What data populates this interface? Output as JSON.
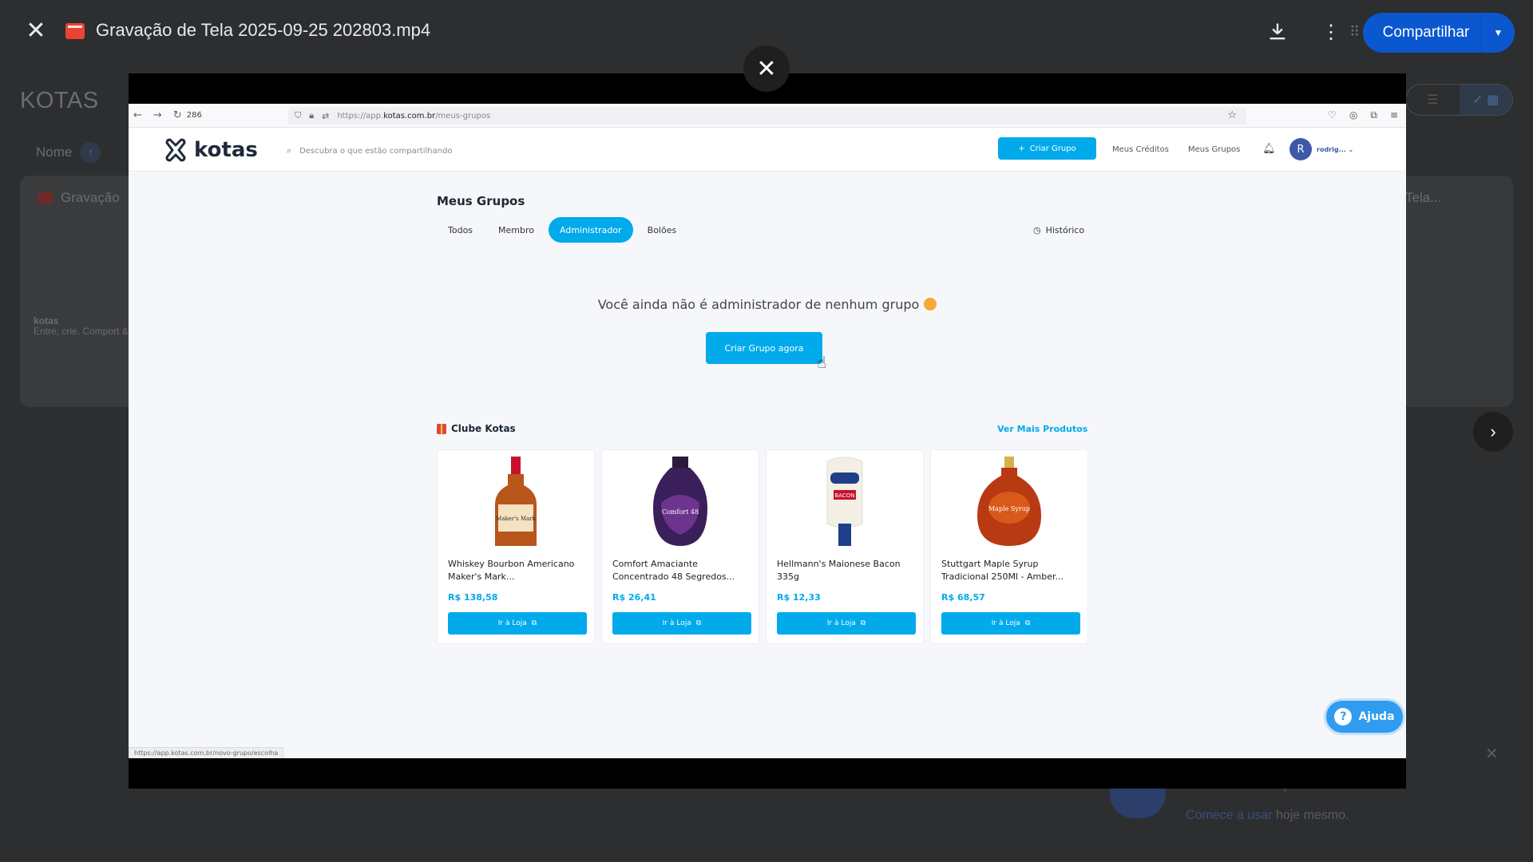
{
  "topbar": {
    "file_title": "Gravação de Tela 2025-09-25 202803.mp4",
    "share_label": "Compartilhar"
  },
  "background": {
    "drive_title": "KOTAS",
    "sort_label": "Nome",
    "card_title": "Gravação",
    "thumb_brand": "kotas",
    "thumb_tagline": "Entre, crie. Comport & curta",
    "right_card_title": "Tela...",
    "toast_line1": "todos os seus arquivos.",
    "toast_link": "Comece a usar",
    "toast_line2_rest": "hoje mesmo."
  },
  "browser": {
    "zoom": "286",
    "url_prefix": "https://app.",
    "url_domain": "kotas.com.br",
    "url_path": "/meus-grupos"
  },
  "kotas": {
    "logo": "kotas",
    "search_placeholder": "Descubra o que estão compartilhando",
    "create_group": "Criar Grupo",
    "my_credits": "Meus Créditos",
    "my_groups": "Meus Grupos",
    "avatar_initial": "R",
    "user_name": "rodrig..."
  },
  "content": {
    "title": "Meus Grupos",
    "tabs": [
      {
        "label": "Todos"
      },
      {
        "label": "Membro"
      },
      {
        "label": "Administrador"
      },
      {
        "label": "Bolões"
      }
    ],
    "history": "Histórico",
    "empty_message": "Você ainda não é administrador de nenhum grupo",
    "cta": "Criar Grupo agora",
    "club_title": "Clube Kotas",
    "more_products": "Ver Mais Produtos",
    "products": [
      {
        "name": "Whiskey Bourbon Americano Maker's Mark...",
        "price": "R$ 138,58",
        "button": "Ir à Loja",
        "image_label": "Maker's Mark"
      },
      {
        "name": "Comfort Amaciante Concentrado 48 Segredos...",
        "price": "R$ 26,41",
        "button": "Ir à Loja",
        "image_label": "Comfort 48"
      },
      {
        "name": "Hellmann's Maionese Bacon 335g",
        "price": "R$ 12,33",
        "button": "Ir à Loja",
        "image_label": "BACON"
      },
      {
        "name": "Stuttgart Maple Syrup Tradicional 250Ml - Amber...",
        "price": "R$ 68,57",
        "button": "Ir à Loja",
        "image_label": "Maple Syrup"
      }
    ],
    "help": "Ajuda",
    "status_url": "https://app.kotas.com.br/novo-grupo/escolha"
  }
}
